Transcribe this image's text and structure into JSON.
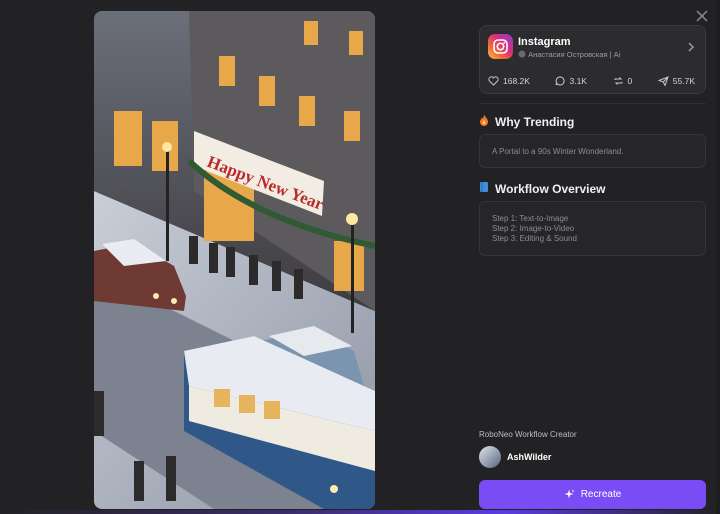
{
  "card": {
    "platform": "Instagram",
    "author": "Анастасия Островская | Ai",
    "likes": "168.2K",
    "comments": "3.1K",
    "reposts": "0",
    "shares": "55.7K"
  },
  "trending": {
    "title": "Why Trending",
    "text": "A Portal to a 90s Winter Wonderland."
  },
  "workflow": {
    "title": "Workflow Overview",
    "steps": [
      "Step 1: Text-to-Image",
      "Step 2: Image-to-Video",
      "Step 3: Editing & Sound"
    ]
  },
  "creator": {
    "label": "RoboNeo Workflow Creator",
    "name": "AshWilder"
  },
  "actions": {
    "recreate": "Recreate"
  },
  "media": {
    "sign_text": "Happy New Year"
  },
  "icons": {
    "close": "close-icon",
    "chevron": "chevron-right-icon",
    "like": "heart-icon",
    "comment": "comment-icon",
    "repost": "repost-icon",
    "share": "share-icon",
    "fire": "fire-icon",
    "book": "book-icon",
    "sparkle": "sparkle-icon"
  },
  "colors": {
    "accent": "#7a4cf6",
    "background": "#222224"
  }
}
